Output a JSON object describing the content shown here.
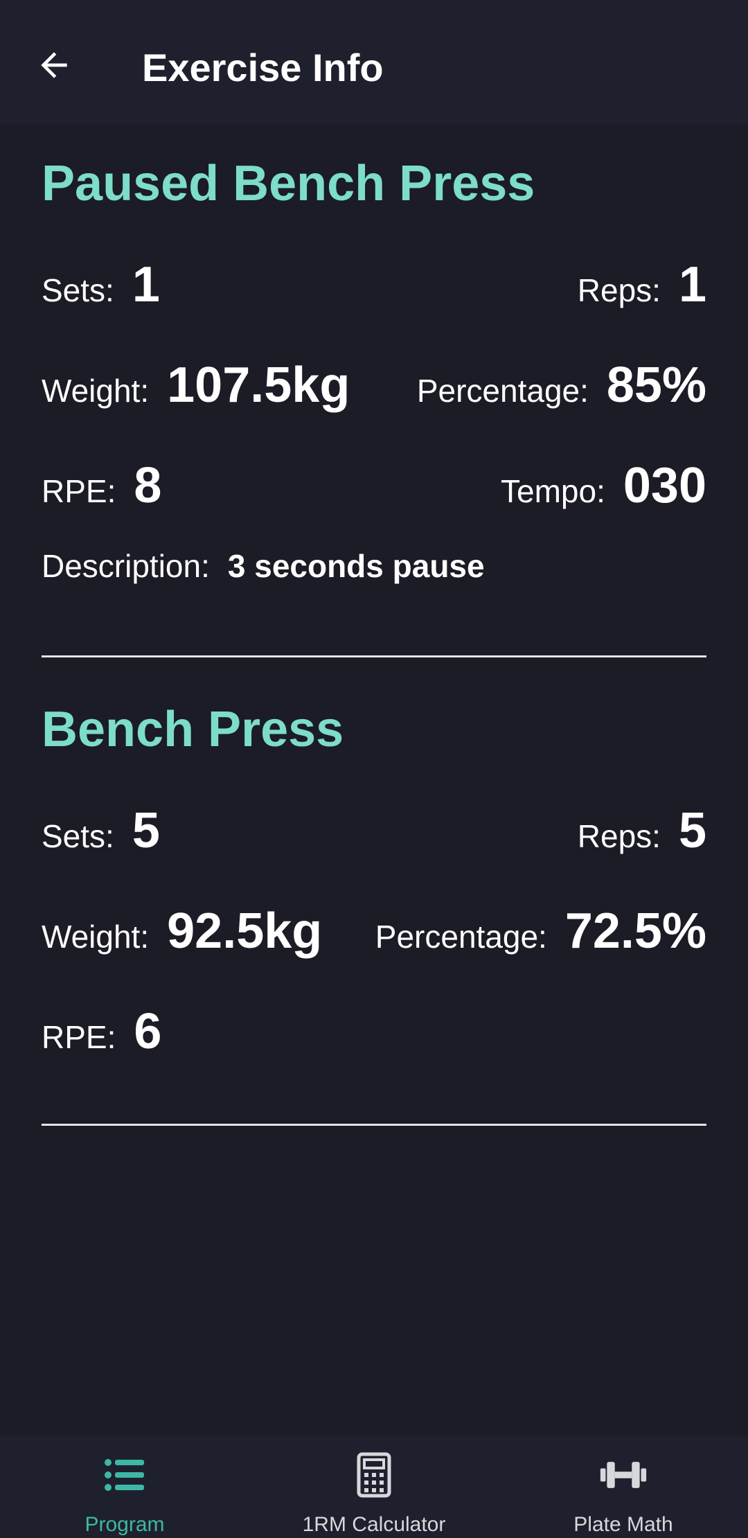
{
  "header": {
    "title": "Exercise Info",
    "back_icon": "arrow-left-icon"
  },
  "exercises": [
    {
      "name": "Paused Bench Press",
      "sets_label": "Sets:",
      "sets": "1",
      "reps_label": "Reps:",
      "reps": "1",
      "weight_label": "Weight:",
      "weight": "107.5kg",
      "percentage_label": "Percentage:",
      "percentage": "85%",
      "rpe_label": "RPE:",
      "rpe": "8",
      "tempo_label": "Tempo:",
      "tempo": "030",
      "description_label": "Description:",
      "description": "3 seconds pause"
    },
    {
      "name": "Bench Press",
      "sets_label": "Sets:",
      "sets": "5",
      "reps_label": "Reps:",
      "reps": "5",
      "weight_label": "Weight:",
      "weight": "92.5kg",
      "percentage_label": "Percentage:",
      "percentage": "72.5%",
      "rpe_label": "RPE:",
      "rpe": "6"
    }
  ],
  "bottom_nav": {
    "items": [
      {
        "label": "Program",
        "icon": "list-icon",
        "active": true
      },
      {
        "label": "1RM Calculator",
        "icon": "calculator-icon",
        "active": false
      },
      {
        "label": "Plate Math",
        "icon": "dumbbell-icon",
        "active": false
      }
    ]
  },
  "colors": {
    "background": "#1b1c25",
    "bar": "#1e212d",
    "accent": "#7ddcca",
    "active_nav": "#3fb7a6"
  }
}
